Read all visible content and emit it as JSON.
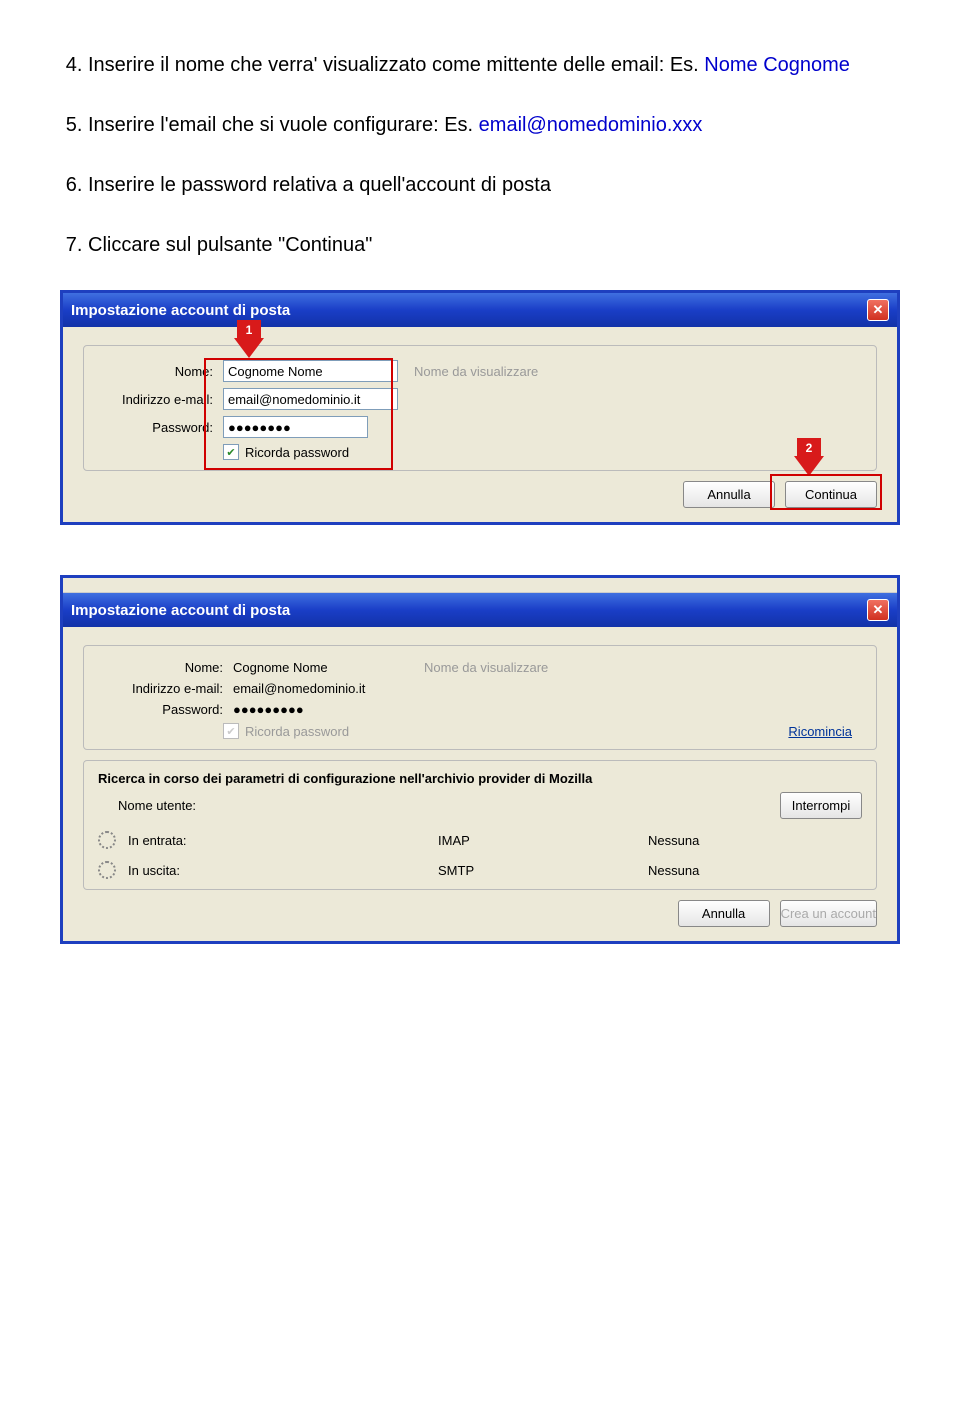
{
  "instructions": {
    "item4": "Inserire il nome che verra' visualizzato come mittente delle email: Es. ",
    "item4_blue": "Nome Cognome",
    "item5": "Inserire l'email che si vuole configurare: Es. ",
    "item5_blue": "email@nomedominio.xxx",
    "item6": "Inserire le password relativa a quell'account di posta",
    "item7": "Cliccare sul pulsante \"Continua\""
  },
  "dialog1": {
    "title": "Impostazione account di posta",
    "name_label": "Nome:",
    "name_value": "Cognome Nome",
    "name_hint": "Nome da visualizzare",
    "email_label": "Indirizzo e-mail:",
    "email_value": "email@nomedominio.it",
    "password_label": "Password:",
    "password_value": "●●●●●●●●",
    "remember_label": "Ricorda password",
    "cancel_btn": "Annulla",
    "continue_btn": "Continua",
    "badge1": "1",
    "badge2": "2"
  },
  "dialog2": {
    "topcrop": "",
    "title": "Impostazione account di posta",
    "name_label": "Nome:",
    "name_value": "Cognome Nome",
    "name_hint": "Nome da visualizzare",
    "email_label": "Indirizzo e-mail:",
    "email_value": "email@nomedominio.it",
    "password_label": "Password:",
    "password_value": "●●●●●●●●●",
    "remember_label": "Ricorda password",
    "restart_link": "Ricomincia",
    "search_text": "Ricerca in corso dei parametri di configurazione nell'archivio provider di Mozilla",
    "username_label": "Nome utente:",
    "interrupt_btn": "Interrompi",
    "incoming_label": "In entrata:",
    "incoming_proto": "IMAP",
    "incoming_sec": "Nessuna",
    "outgoing_label": "In uscita:",
    "outgoing_proto": "SMTP",
    "outgoing_sec": "Nessuna",
    "cancel_btn": "Annulla",
    "create_btn": "Crea un account"
  }
}
